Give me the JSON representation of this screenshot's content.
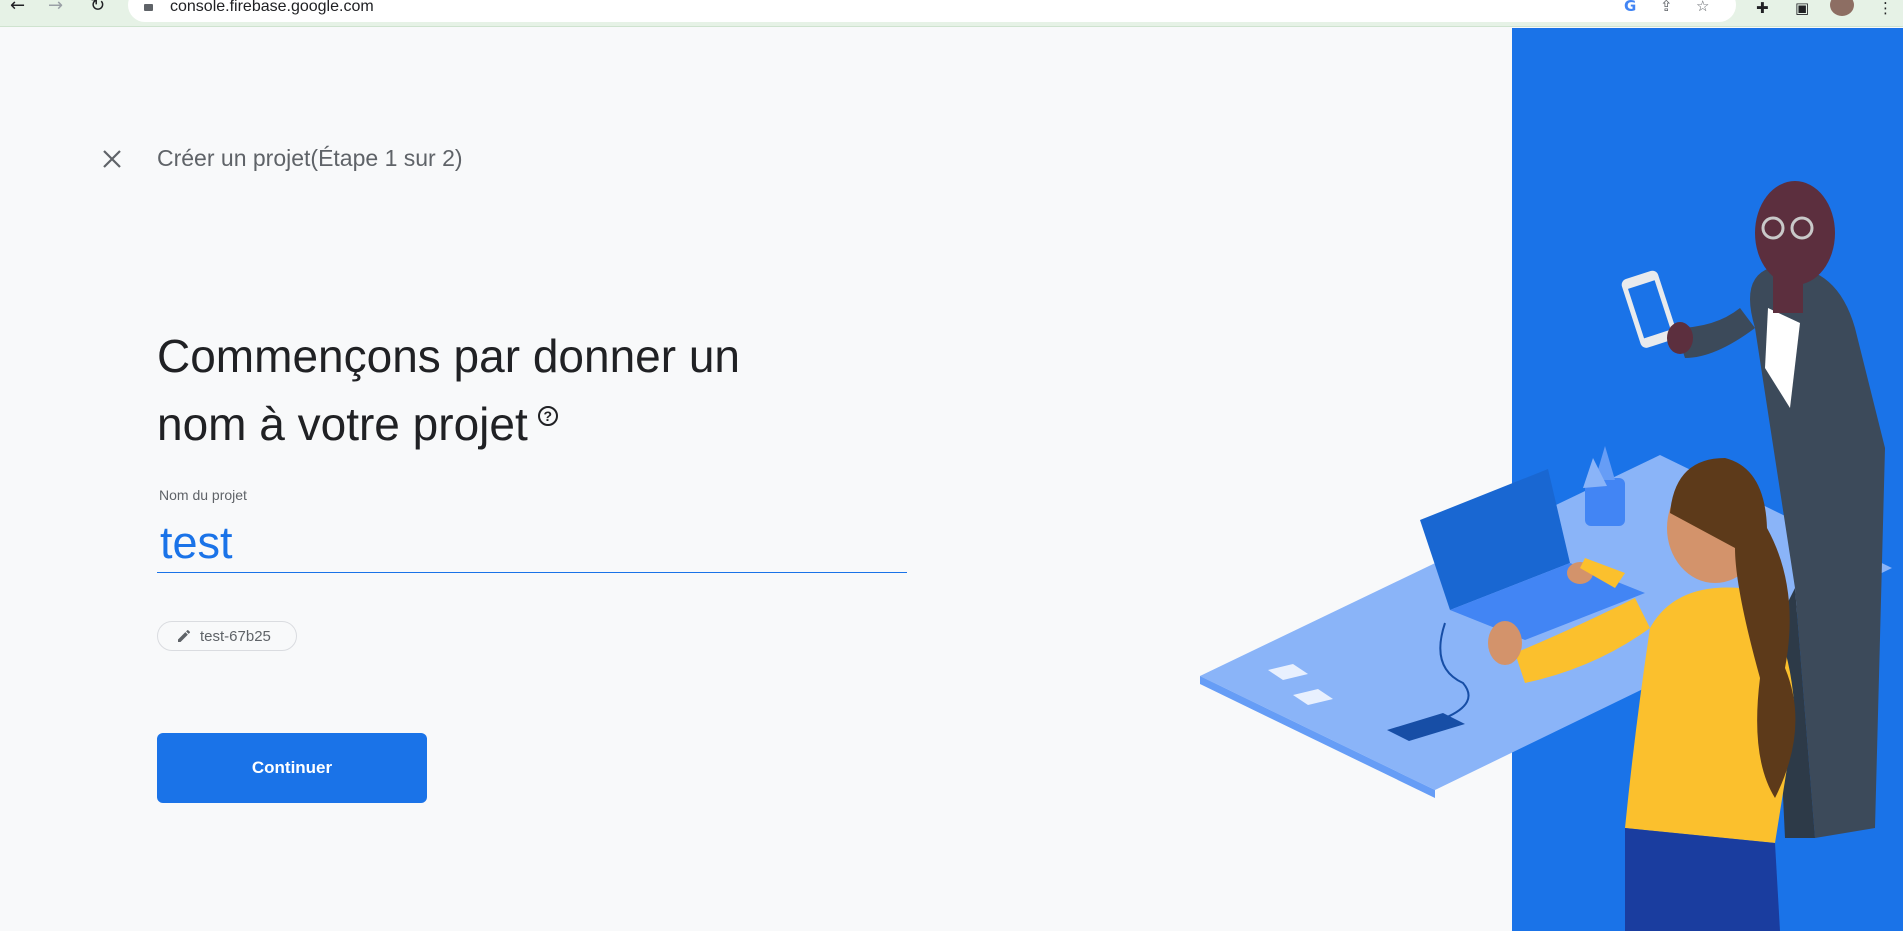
{
  "browser": {
    "url": "console.firebase.google.com",
    "icons": [
      "back-icon",
      "forward-icon",
      "reload-icon",
      "lock-icon",
      "google-icon",
      "share-icon",
      "star-icon",
      "extensions-icon",
      "sidepanel-icon",
      "profile-avatar",
      "menu-icon"
    ]
  },
  "header": {
    "step_title": "Créer un projet(Étape 1 sur 2)"
  },
  "main": {
    "heading_line1": "Commençons par donner un",
    "heading_line2": "nom à votre projet",
    "help_glyph": "?",
    "field_label": "Nom du projet",
    "field_value": "test",
    "project_id": "test-67b25",
    "continue_label": "Continuer"
  },
  "colors": {
    "accent": "#1a73e8",
    "illustration_bg": "#1a73e8",
    "page_bg": "#f8f9fa"
  }
}
